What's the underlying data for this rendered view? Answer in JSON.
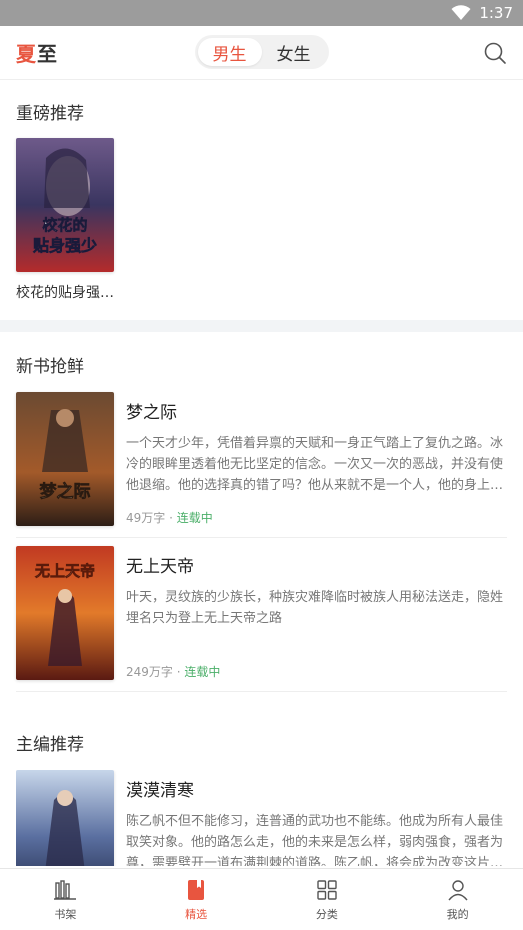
{
  "status": {
    "time": "1:37"
  },
  "header": {
    "logo_a": "夏",
    "logo_b": "至",
    "tabs": [
      {
        "label": "男生"
      },
      {
        "label": "女生"
      }
    ],
    "active_tab": 0
  },
  "featured": {
    "title": "重磅推荐",
    "books": [
      {
        "title": "校花的贴身强…",
        "cover_text": "校花的贴身强少",
        "cover_color": "#2a3550"
      }
    ]
  },
  "new_books": {
    "title": "新书抢鲜",
    "books": [
      {
        "title": "梦之际",
        "desc": "一个天才少年，凭借着异禀的天赋和一身正气踏上了复仇之路。冰冷的眼眸里透着他无比坚定的信念。一次又一次的恶战，并没有使他退缩。他的选择真的错了吗？他从来就不是一个人，他的身上…",
        "words": "49万字",
        "status": "连载中",
        "cover_text": "梦之际",
        "cover_color": "#5a3a2a"
      },
      {
        "title": "无上天帝",
        "desc": "叶天，灵纹族的少族长，种族灾难降临时被族人用秘法送走，隐姓埋名只为登上无上天帝之路",
        "words": "249万字",
        "status": "连载中",
        "cover_text": "无上天帝",
        "cover_color": "#8a2a1c"
      }
    ]
  },
  "editor_picks": {
    "title": "主编推荐",
    "books": [
      {
        "title": "漠漠清寒",
        "desc": "陈乙帆不但不能修习，连普通的武功也不能练。他成为所有人最佳取笑对象。他的路怎么走，他的未来是怎么样，弱肉强食，强者为尊，需要劈开一道布满荆棘的道路。陈乙帆，将会成为改变这片…",
        "cover_color": "#3b4a78"
      }
    ]
  },
  "tabbar": {
    "items": [
      {
        "label": "书架",
        "icon": "bookshelf-icon"
      },
      {
        "label": "精选",
        "icon": "bookmark-book-icon"
      },
      {
        "label": "分类",
        "icon": "grid-icon"
      },
      {
        "label": "我的",
        "icon": "user-icon"
      }
    ],
    "active": 1
  },
  "colors": {
    "accent": "#e8553f",
    "serial": "#4caf6a"
  }
}
